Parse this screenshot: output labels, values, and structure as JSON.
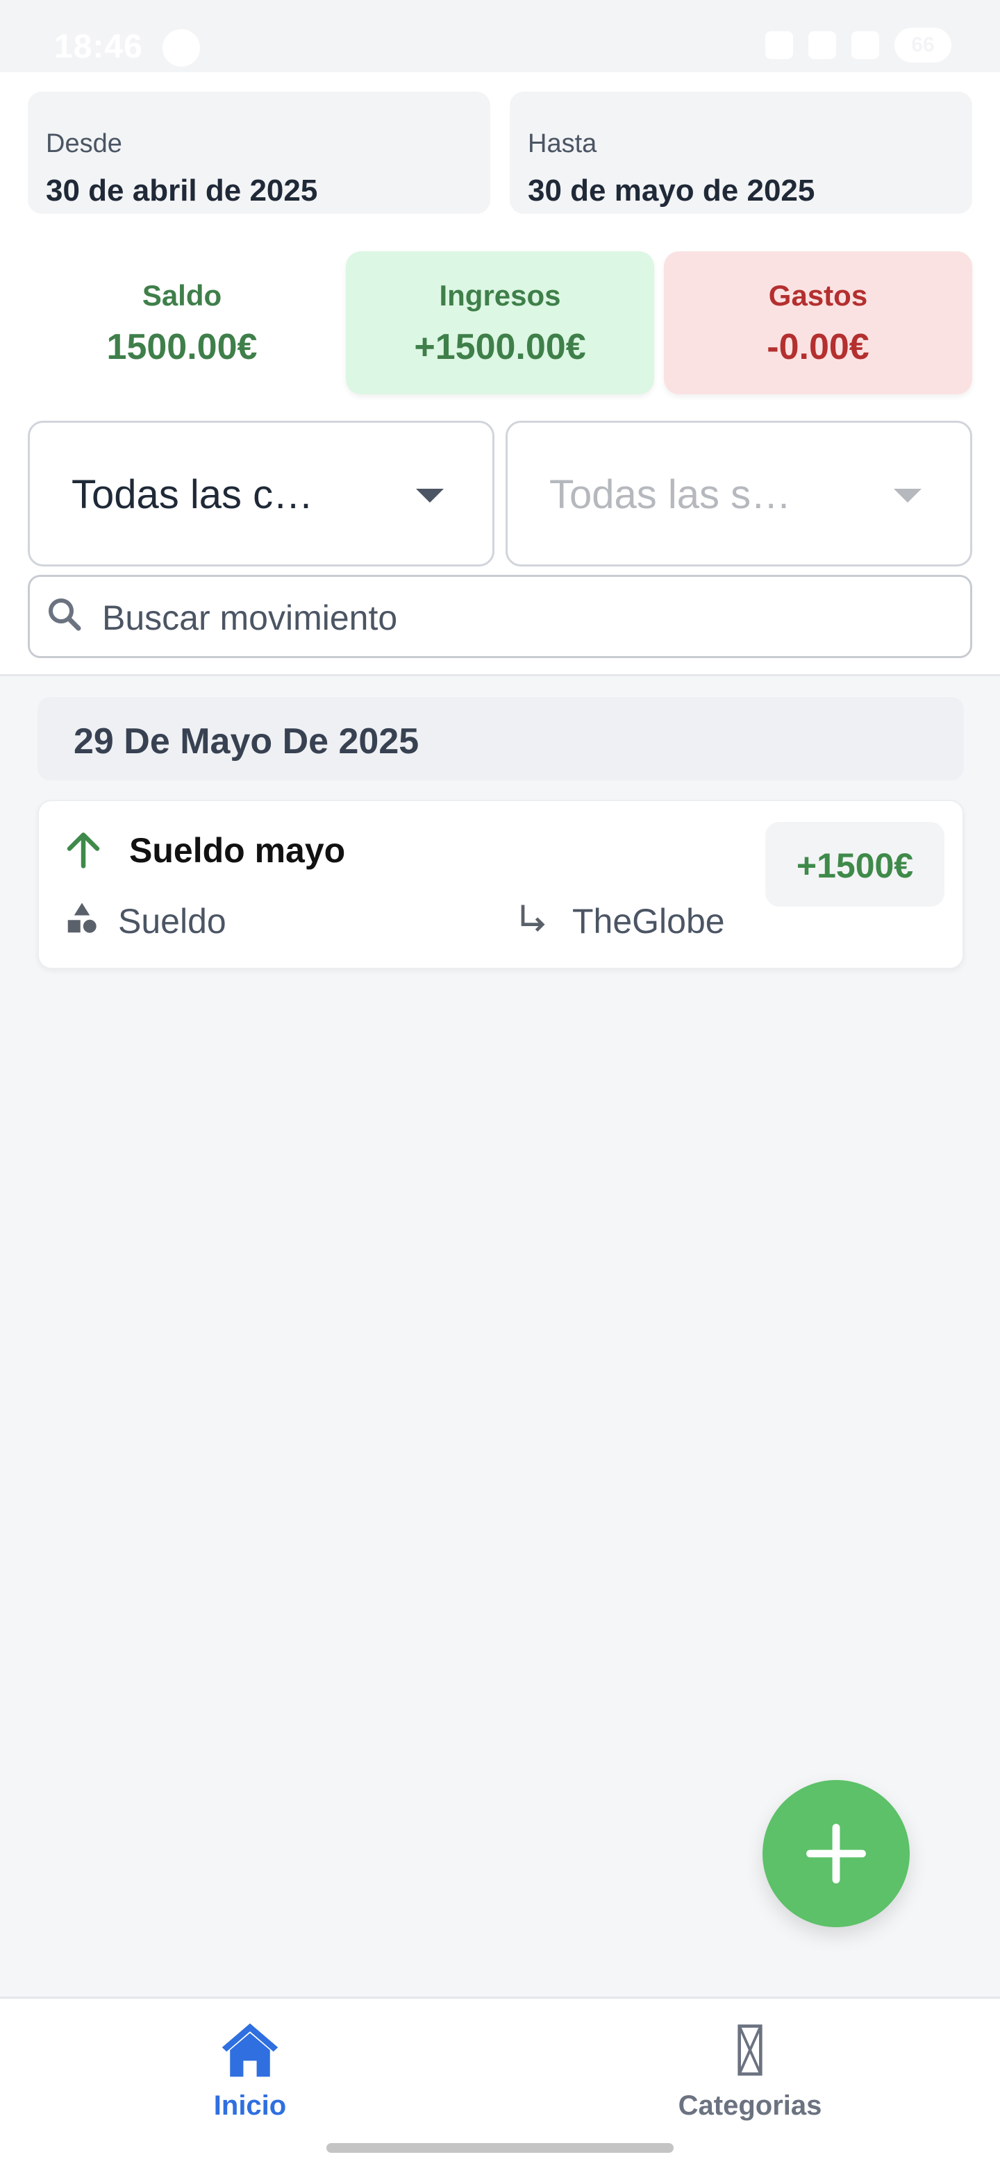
{
  "status_bar": {
    "time": "18:46",
    "battery": "66"
  },
  "filters": {
    "from_label": "Desde",
    "from_value": "30 de abril de 2025",
    "to_label": "Hasta",
    "to_value": "30 de mayo de 2025"
  },
  "summary": {
    "saldo_label": "Saldo",
    "saldo_value": "1500.00€",
    "ingresos_label": "Ingresos",
    "ingresos_value": "+1500.00€",
    "gastos_label": "Gastos",
    "gastos_value": "-0.00€"
  },
  "selects": {
    "category_value": "Todas las c…",
    "subcategory_value": "Todas las s…"
  },
  "search": {
    "placeholder": "Buscar movimiento",
    "value": ""
  },
  "groups": [
    {
      "date": "29 De Mayo De 2025",
      "transactions": [
        {
          "title": "Sueldo mayo",
          "category": "Sueldo",
          "account": "TheGlobe",
          "amount": "+1500€",
          "direction_icon": "arrow-up-icon"
        }
      ]
    }
  ],
  "bottom_nav": {
    "items": [
      {
        "label": "Inicio",
        "icon": "home-icon",
        "active": true
      },
      {
        "label": "Categorias",
        "icon": "categories-icon",
        "active": false
      }
    ]
  },
  "colors": {
    "income_green": "#3f7f4a",
    "expense_red": "#b42f2f",
    "fab_green": "#5cc168",
    "active_blue": "#2f6fe0"
  }
}
